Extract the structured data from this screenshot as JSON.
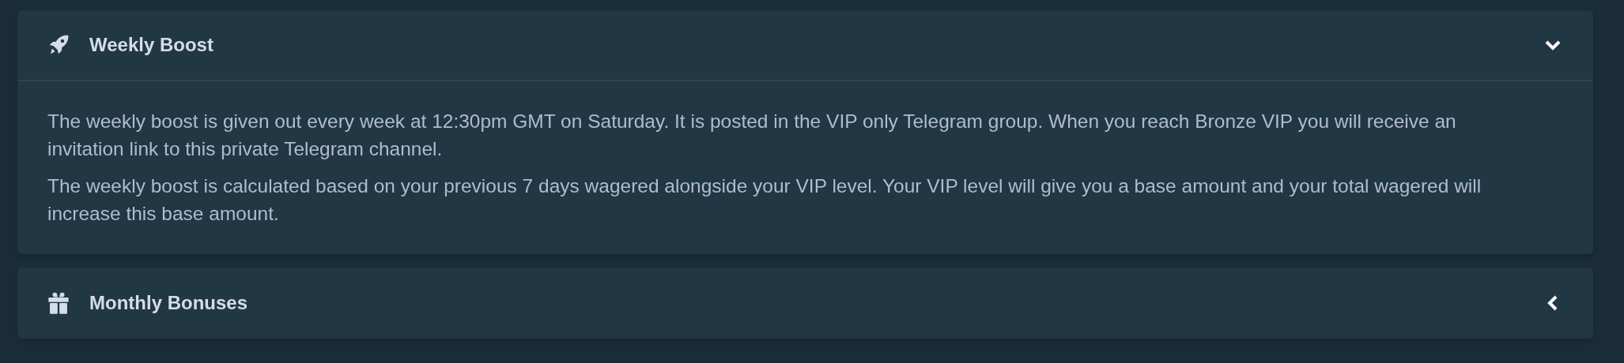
{
  "sections": [
    {
      "kind": "rocket",
      "title": "Weekly Boost",
      "expanded": true,
      "paragraphs": [
        "The weekly boost is given out every week at 12:30pm GMT on Saturday. It is posted in the VIP only Telegram group. When you reach Bronze VIP you will receive an invitation link to this private Telegram channel.",
        "The weekly boost is calculated based on your previous 7 days wagered alongside your VIP level. Your VIP level will give you a base amount and your total wagered will increase this base amount."
      ]
    },
    {
      "kind": "gift",
      "title": "Monthly Bonuses",
      "expanded": false
    }
  ]
}
